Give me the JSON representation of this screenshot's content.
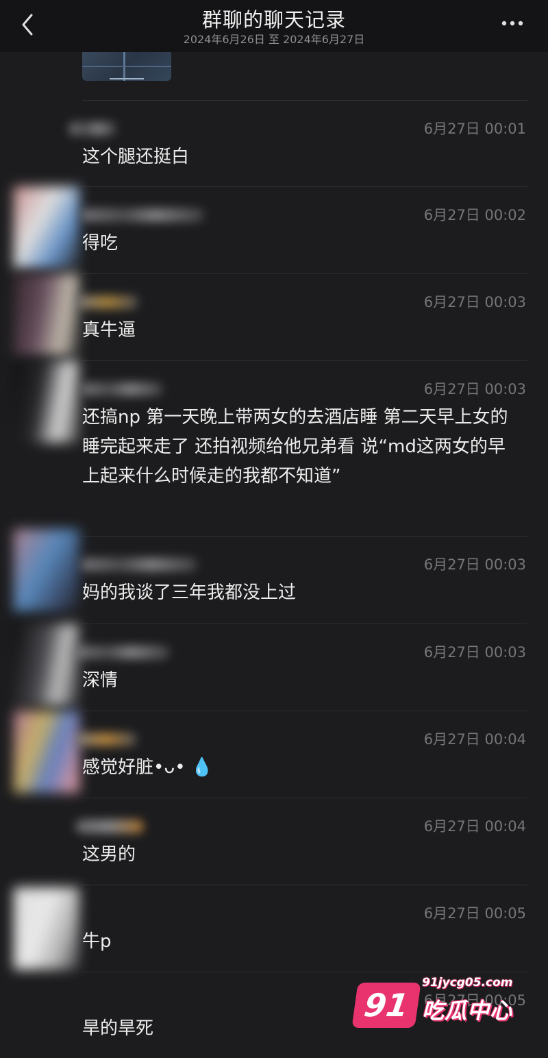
{
  "header": {
    "title": "群聊的聊天记录",
    "subtitle": "2024年6月26日 至 2024年6月27日",
    "back_icon": "chevron-left-icon",
    "more_icon": "more-horizontal-icon"
  },
  "messages": [
    {
      "time": "6月27日 00:01",
      "text": "这个腿还挺白"
    },
    {
      "time": "6月27日 00:02",
      "text": "得吃"
    },
    {
      "time": "6月27日 00:03",
      "text": "真牛逼"
    },
    {
      "time": "6月27日 00:03",
      "text": "还搞np 第一天晚上带两女的去酒店睡 第二天早上女的睡完起来走了 还拍视频给他兄弟看 说“md这两女的早上起来什么时候走的我都不知道”"
    },
    {
      "time": "6月27日 00:03",
      "text": "妈的我谈了三年我都没上过"
    },
    {
      "time": "6月27日 00:03",
      "text": "深情"
    },
    {
      "time": "6月27日 00:04",
      "text": "感觉好脏•ᴗ• 💧"
    },
    {
      "time": "6月27日 00:04",
      "text": "这男的"
    },
    {
      "time": "6月27日 00:05",
      "text": "牛p"
    },
    {
      "time": "6月27日 00:05",
      "text": "旱的旱死"
    }
  ],
  "watermark": {
    "logo_number": "91",
    "url": "91jycg05.com",
    "name": "吃瓜中心"
  },
  "colors": {
    "background": "#1c1c1e",
    "header": "#141416",
    "text": "#ececec",
    "time": "#76767b",
    "watermark_accent": "#e8336f"
  }
}
